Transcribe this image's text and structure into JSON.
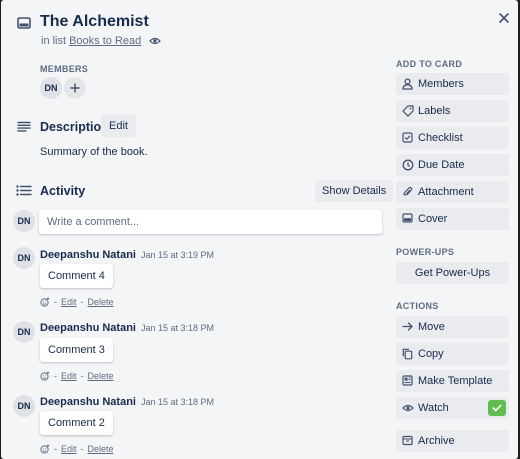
{
  "card": {
    "title": "The Alchemist",
    "in_list_prefix": "in list",
    "list_name": "Books to Read"
  },
  "members": {
    "label": "MEMBERS",
    "avatar_initials": "DN"
  },
  "description": {
    "heading": "Description",
    "edit_label": "Edit",
    "text": "Summary of the book."
  },
  "activity": {
    "heading": "Activity",
    "show_details_label": "Show Details",
    "current_user_initials": "DN",
    "comment_placeholder": "Write a comment...",
    "comments": [
      {
        "initials": "DN",
        "author": "Deepanshu Natani",
        "time": "Jan 15 at 3:19 PM",
        "text": "Comment 4",
        "dash": "-",
        "edit": "Edit",
        "sep": "-",
        "delete": "Delete"
      },
      {
        "initials": "DN",
        "author": "Deepanshu Natani",
        "time": "Jan 15 at 3:18 PM",
        "text": "Comment 3",
        "dash": "-",
        "edit": "Edit",
        "sep": "-",
        "delete": "Delete"
      },
      {
        "initials": "DN",
        "author": "Deepanshu Natani",
        "time": "Jan 15 at 3:18 PM",
        "text": "Comment 2",
        "dash": "-",
        "edit": "Edit",
        "sep": "-",
        "delete": "Delete"
      }
    ]
  },
  "sidebar": {
    "add_to_card_label": "ADD TO CARD",
    "add_to_card": [
      {
        "label": "Members",
        "icon": "person-icon"
      },
      {
        "label": "Labels",
        "icon": "tag-icon"
      },
      {
        "label": "Checklist",
        "icon": "checklist-icon"
      },
      {
        "label": "Due Date",
        "icon": "clock-icon"
      },
      {
        "label": "Attachment",
        "icon": "paperclip-icon"
      },
      {
        "label": "Cover",
        "icon": "cover-icon"
      }
    ],
    "power_ups_label": "POWER-UPS",
    "get_power_ups_label": "Get Power-Ups",
    "actions_label": "ACTIONS",
    "actions": [
      {
        "label": "Move",
        "icon": "arrow-right-icon"
      },
      {
        "label": "Copy",
        "icon": "copy-icon"
      },
      {
        "label": "Make Template",
        "icon": "template-icon"
      },
      {
        "label": "Watch",
        "icon": "eye-icon"
      },
      {
        "label": "Archive",
        "icon": "archive-icon"
      }
    ]
  },
  "colors": {
    "watch_check": "#61bd4f"
  }
}
